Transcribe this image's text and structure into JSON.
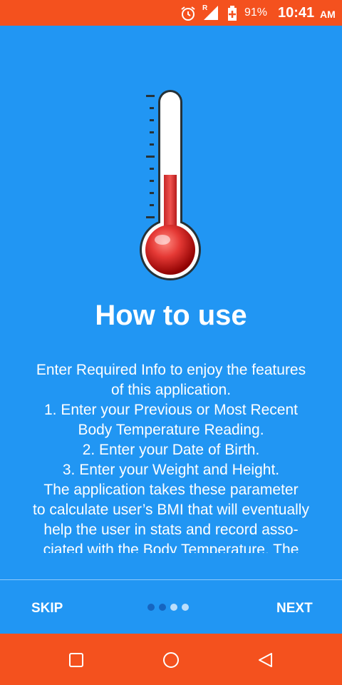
{
  "status_bar": {
    "roaming": "R",
    "battery_percent": "91%",
    "time": "10:41",
    "ampm": "AM",
    "icons": [
      "alarm-icon",
      "signal-icon",
      "battery-charging-icon"
    ]
  },
  "onboarding": {
    "title": "How to use",
    "lines": [
      "Enter Required Info to enjoy the features",
      "of this application.",
      "1.   Enter your Previous or Most Recent",
      "Body Temperature Reading.",
      "2.   Enter your Date of Birth.",
      "3.   Enter your Weight and Height.",
      "The application takes these parameter",
      "to calculate user’s BMI that will eventually",
      "help the user in stats and record asso-",
      "ciated with the Body Temperature. The"
    ],
    "skip_label": "SKIP",
    "next_label": "NEXT",
    "page_indicator": {
      "count": 4,
      "active": [
        2,
        3
      ]
    },
    "image": "thermometer-icon"
  },
  "nav_bar": {
    "icons": [
      "recent-apps-icon",
      "home-icon",
      "back-icon"
    ]
  },
  "colors": {
    "background": "#2196f3",
    "status_bar": "#f4511e",
    "nav_bar": "#f4511e",
    "thermometer_fill": "#e53935"
  }
}
